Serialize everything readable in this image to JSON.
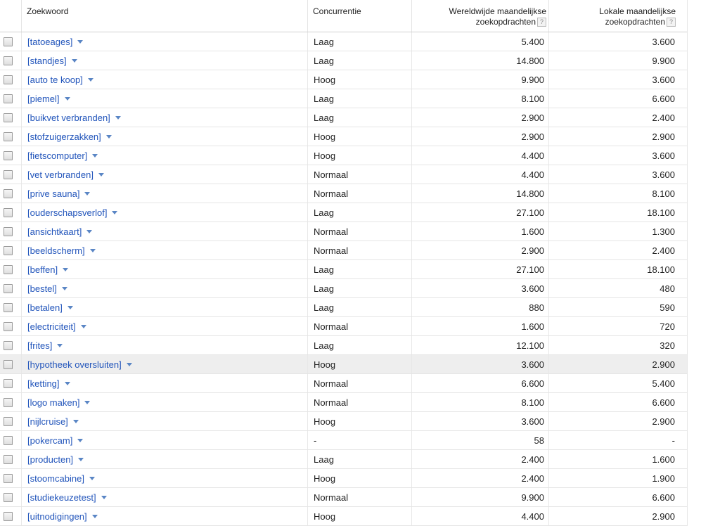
{
  "header": {
    "keyword": "Zoekwoord",
    "competition": "Concurrentie",
    "global_line1": "Wereldwijde maandelijkse",
    "global_line2": "zoekopdrachten",
    "local_line1": "Lokale maandelijkse",
    "local_line2": "zoekopdrachten",
    "help": "?"
  },
  "rows": [
    {
      "keyword": "[tatoeages]",
      "competition": "Laag",
      "global": "5.400",
      "local": "3.600"
    },
    {
      "keyword": "[standjes]",
      "competition": "Laag",
      "global": "14.800",
      "local": "9.900"
    },
    {
      "keyword": "[auto te koop]",
      "competition": "Hoog",
      "global": "9.900",
      "local": "3.600"
    },
    {
      "keyword": "[piemel]",
      "competition": "Laag",
      "global": "8.100",
      "local": "6.600"
    },
    {
      "keyword": "[buikvet verbranden]",
      "competition": "Laag",
      "global": "2.900",
      "local": "2.400"
    },
    {
      "keyword": "[stofzuigerzakken]",
      "competition": "Hoog",
      "global": "2.900",
      "local": "2.900"
    },
    {
      "keyword": "[fietscomputer]",
      "competition": "Hoog",
      "global": "4.400",
      "local": "3.600"
    },
    {
      "keyword": "[vet verbranden]",
      "competition": "Normaal",
      "global": "4.400",
      "local": "3.600"
    },
    {
      "keyword": "[prive sauna]",
      "competition": "Normaal",
      "global": "14.800",
      "local": "8.100"
    },
    {
      "keyword": "[ouderschapsverlof]",
      "competition": "Laag",
      "global": "27.100",
      "local": "18.100"
    },
    {
      "keyword": "[ansichtkaart]",
      "competition": "Normaal",
      "global": "1.600",
      "local": "1.300"
    },
    {
      "keyword": "[beeldscherm]",
      "competition": "Normaal",
      "global": "2.900",
      "local": "2.400"
    },
    {
      "keyword": "[beffen]",
      "competition": "Laag",
      "global": "27.100",
      "local": "18.100"
    },
    {
      "keyword": "[bestel]",
      "competition": "Laag",
      "global": "3.600",
      "local": "480"
    },
    {
      "keyword": "[betalen]",
      "competition": "Laag",
      "global": "880",
      "local": "590"
    },
    {
      "keyword": "[electriciteit]",
      "competition": "Normaal",
      "global": "1.600",
      "local": "720"
    },
    {
      "keyword": "[frites]",
      "competition": "Laag",
      "global": "12.100",
      "local": "320"
    },
    {
      "keyword": "[hypotheek oversluiten]",
      "competition": "Hoog",
      "global": "3.600",
      "local": "2.900",
      "highlight": true
    },
    {
      "keyword": "[ketting]",
      "competition": "Normaal",
      "global": "6.600",
      "local": "5.400"
    },
    {
      "keyword": "[logo maken]",
      "competition": "Normaal",
      "global": "8.100",
      "local": "6.600"
    },
    {
      "keyword": "[nijlcruise]",
      "competition": "Hoog",
      "global": "3.600",
      "local": "2.900"
    },
    {
      "keyword": "[pokercam]",
      "competition": "-",
      "global": "58",
      "local": "-"
    },
    {
      "keyword": "[producten]",
      "competition": "Laag",
      "global": "2.400",
      "local": "1.600"
    },
    {
      "keyword": "[stoomcabine]",
      "competition": "Hoog",
      "global": "2.400",
      "local": "1.900"
    },
    {
      "keyword": "[studiekeuzetest]",
      "competition": "Normaal",
      "global": "9.900",
      "local": "6.600"
    },
    {
      "keyword": "[uitnodigingen]",
      "competition": "Hoog",
      "global": "4.400",
      "local": "2.900"
    }
  ]
}
